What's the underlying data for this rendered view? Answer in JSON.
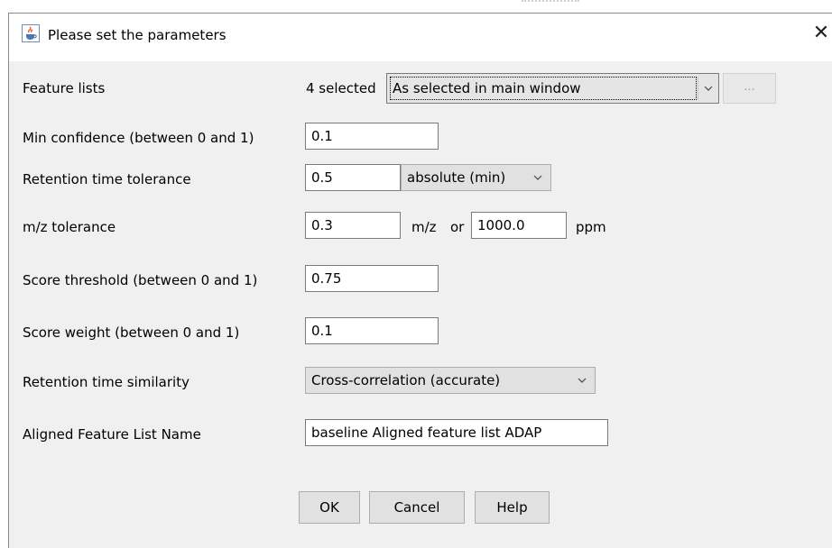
{
  "window": {
    "title": "Please set the parameters",
    "icon": "java-cup-icon",
    "close_label": "✕"
  },
  "params": {
    "feature_lists": {
      "label": "Feature lists",
      "count_text": "4 selected",
      "selected_option": "As selected in main window",
      "extra_button_label": "..."
    },
    "min_confidence": {
      "label": "Min confidence (between 0 and 1)",
      "value": "0.1"
    },
    "rt_tolerance": {
      "label": "Retention time tolerance",
      "value": "0.5",
      "unit_option": "absolute (min)"
    },
    "mz_tolerance": {
      "label": "m/z tolerance",
      "mz_value": "0.3",
      "mz_unit": "m/z",
      "or_text": "or",
      "ppm_value": "1000.0",
      "ppm_unit": "ppm"
    },
    "score_threshold": {
      "label": "Score threshold (between 0 and 1)",
      "value": "0.75"
    },
    "score_weight": {
      "label": "Score weight (between 0 and 1)",
      "value": "0.1"
    },
    "rt_similarity": {
      "label": "Retention time similarity",
      "selected_option": "Cross-correlation (accurate)"
    },
    "aligned_name": {
      "label": "Aligned Feature List Name",
      "value": "baseline Aligned feature list ADAP"
    }
  },
  "buttons": {
    "ok": "OK",
    "cancel": "Cancel",
    "help": "Help"
  }
}
